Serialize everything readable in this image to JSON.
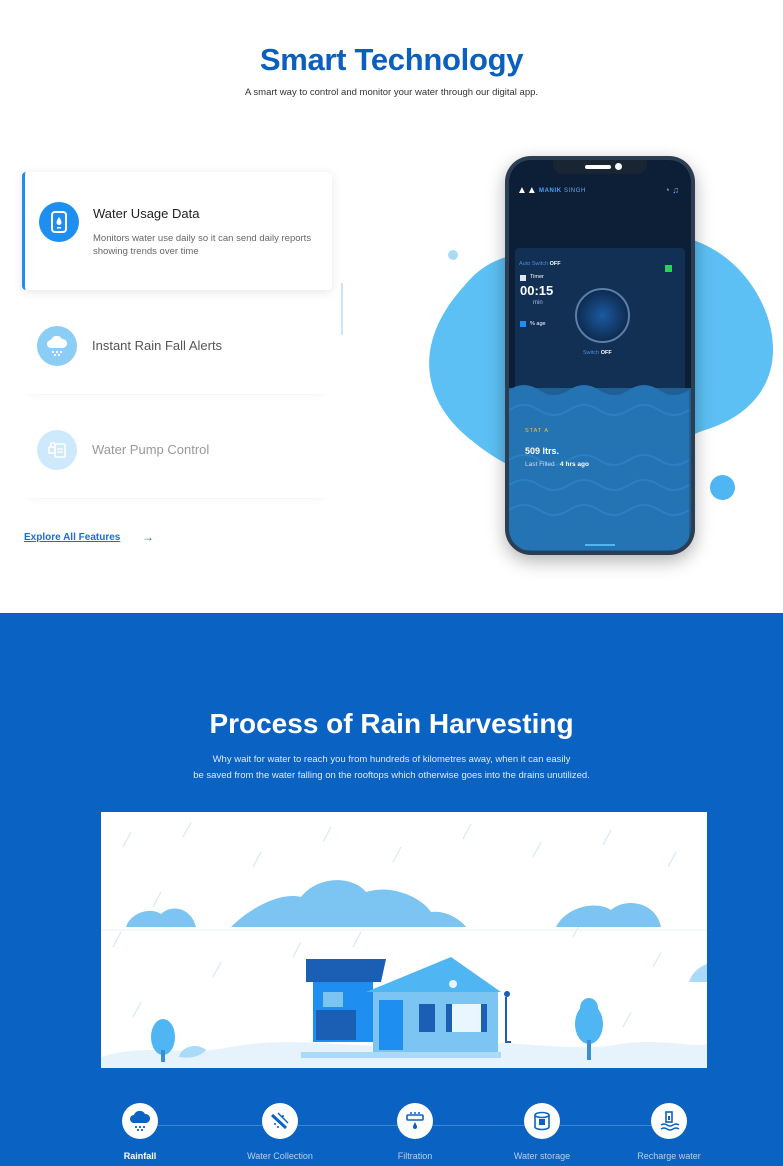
{
  "top_section": {
    "title": "Smart Technology",
    "subtitle": "A smart way to control and monitor your water through our digital app.",
    "features": [
      {
        "title": "Water Usage Data",
        "description": "Monitors water use daily so it can send daily reports showing trends over time",
        "icon": "phone-water-icon",
        "active": true
      },
      {
        "title": "Instant Rain Fall Alerts",
        "icon": "rain-cloud-icon",
        "active": false
      },
      {
        "title": "Water Pump Control",
        "icon": "pump-icon",
        "active": false
      }
    ],
    "explore_link": "Explore All Features",
    "explore_arrow": "→"
  },
  "phone_app": {
    "logo": "▲▲",
    "user_first": "MANIK",
    "user_last": " SINGH",
    "header_icons": "◔ ♫",
    "auto_switch_label": "Auto Switch",
    "auto_switch_state": "OFF",
    "timer_label": "Timer",
    "timer_value": "00:15",
    "timer_unit": "min",
    "percent_label": "% age",
    "switch_label": "Switch",
    "switch_state": "OFF",
    "stat_label": "STAT A",
    "stat_value": "509 ltrs.",
    "last_filled_label": "Last Filled",
    "last_filled_value": "4 hrs ago"
  },
  "process_section": {
    "title": "Process of Rain Harvesting",
    "subtitle_line1": "Why wait for water to reach you from hundreds of kilometres away, when it can easily",
    "subtitle_line2": "be saved from the water falling on the rooftops which otherwise goes into the drains unutilized.",
    "steps": [
      {
        "label": "Rainfall",
        "icon": "rain-cloud-icon",
        "active": true
      },
      {
        "label": "Water Collection",
        "icon": "pipe-icon",
        "active": false
      },
      {
        "label": "Filtration",
        "icon": "filter-icon",
        "active": false
      },
      {
        "label": "Water storage",
        "icon": "tank-icon",
        "active": false
      },
      {
        "label": "Recharge water",
        "icon": "recharge-icon",
        "active": false
      }
    ]
  },
  "colors": {
    "brand_blue": "#0b5fbd",
    "section_blue": "#0a63c2",
    "accent": "#1e8ef0",
    "light_blob": "#4fb6f3"
  }
}
